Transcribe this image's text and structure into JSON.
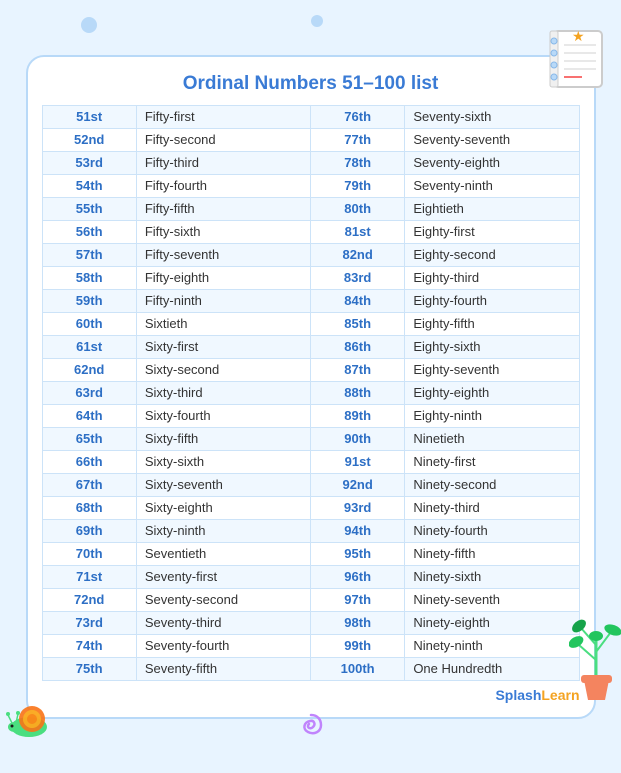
{
  "title": "Ordinal Numbers 51–100 list",
  "brand": {
    "splash": "Splash",
    "learn": "Learn"
  },
  "rows": [
    {
      "num1": "51st",
      "word1": "Fifty-first",
      "num2": "76th",
      "word2": "Seventy-sixth"
    },
    {
      "num1": "52nd",
      "word1": "Fifty-second",
      "num2": "77th",
      "word2": "Seventy-seventh"
    },
    {
      "num1": "53rd",
      "word1": "Fifty-third",
      "num2": "78th",
      "word2": "Seventy-eighth"
    },
    {
      "num1": "54th",
      "word1": "Fifty-fourth",
      "num2": "79th",
      "word2": "Seventy-ninth"
    },
    {
      "num1": "55th",
      "word1": "Fifty-fifth",
      "num2": "80th",
      "word2": "Eightieth"
    },
    {
      "num1": "56th",
      "word1": "Fifty-sixth",
      "num2": "81st",
      "word2": "Eighty-first"
    },
    {
      "num1": "57th",
      "word1": "Fifty-seventh",
      "num2": "82nd",
      "word2": "Eighty-second"
    },
    {
      "num1": "58th",
      "word1": "Fifty-eighth",
      "num2": "83rd",
      "word2": "Eighty-third"
    },
    {
      "num1": "59th",
      "word1": "Fifty-ninth",
      "num2": "84th",
      "word2": "Eighty-fourth"
    },
    {
      "num1": "60th",
      "word1": "Sixtieth",
      "num2": "85th",
      "word2": "Eighty-fifth"
    },
    {
      "num1": "61st",
      "word1": "Sixty-first",
      "num2": "86th",
      "word2": "Eighty-sixth"
    },
    {
      "num1": "62nd",
      "word1": "Sixty-second",
      "num2": "87th",
      "word2": "Eighty-seventh"
    },
    {
      "num1": "63rd",
      "word1": "Sixty-third",
      "num2": "88th",
      "word2": "Eighty-eighth"
    },
    {
      "num1": "64th",
      "word1": "Sixty-fourth",
      "num2": "89th",
      "word2": "Eighty-ninth"
    },
    {
      "num1": "65th",
      "word1": "Sixty-fifth",
      "num2": "90th",
      "word2": "Ninetieth"
    },
    {
      "num1": "66th",
      "word1": "Sixty-sixth",
      "num2": "91st",
      "word2": "Ninety-first"
    },
    {
      "num1": "67th",
      "word1": "Sixty-seventh",
      "num2": "92nd",
      "word2": "Ninety-second"
    },
    {
      "num1": "68th",
      "word1": "Sixty-eighth",
      "num2": "93rd",
      "word2": "Ninety-third"
    },
    {
      "num1": "69th",
      "word1": "Sixty-ninth",
      "num2": "94th",
      "word2": "Ninety-fourth"
    },
    {
      "num1": "70th",
      "word1": "Seventieth",
      "num2": "95th",
      "word2": "Ninety-fifth"
    },
    {
      "num1": "71st",
      "word1": "Seventy-first",
      "num2": "96th",
      "word2": "Ninety-sixth"
    },
    {
      "num1": "72nd",
      "word1": "Seventy-second",
      "num2": "97th",
      "word2": "Ninety-seventh"
    },
    {
      "num1": "73rd",
      "word1": "Seventy-third",
      "num2": "98th",
      "word2": "Ninety-eighth"
    },
    {
      "num1": "74th",
      "word1": "Seventy-fourth",
      "num2": "99th",
      "word2": "Ninety-ninth"
    },
    {
      "num1": "75th",
      "word1": "Seventy-fifth",
      "num2": "100th",
      "word2": "One Hundredth"
    }
  ]
}
